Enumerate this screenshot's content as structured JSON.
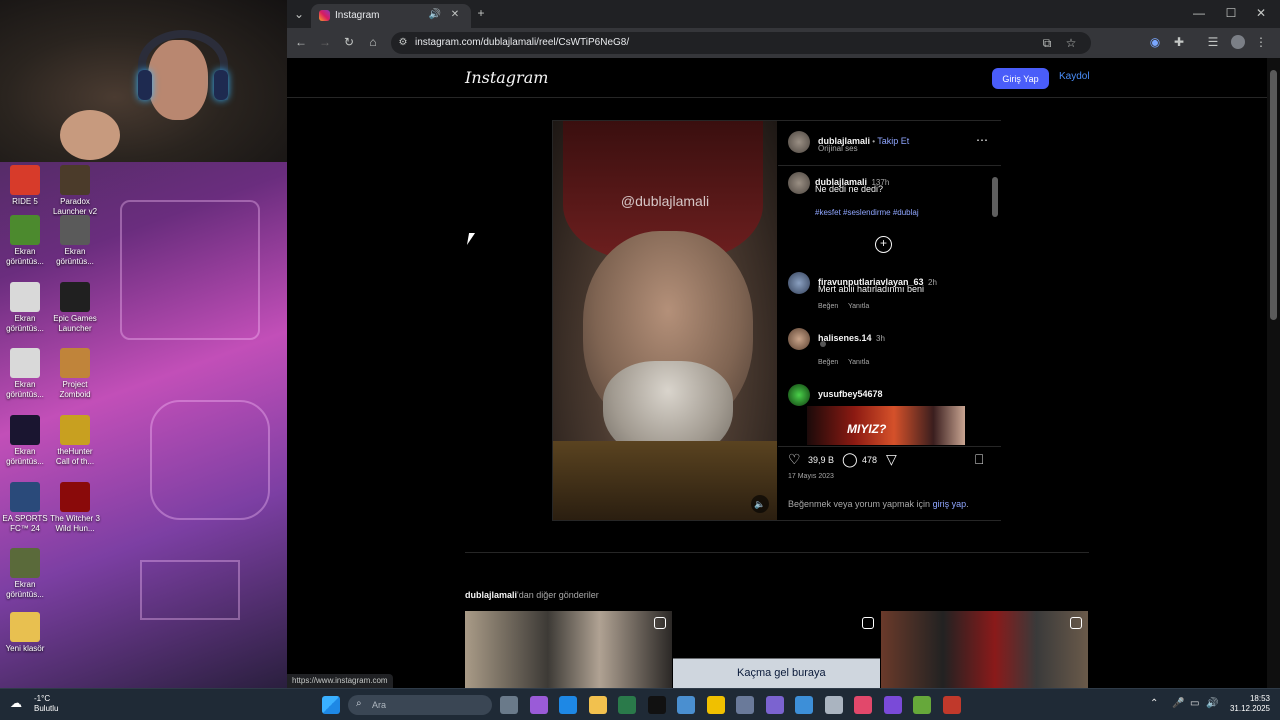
{
  "desktop": {
    "icons": [
      {
        "label": "RIDE 5",
        "color": "#d73b2a"
      },
      {
        "label": "Paradox Launcher v2",
        "color": "#4b3b2a"
      },
      {
        "label": "Ekran görüntüs...",
        "color": "#4c8a2e"
      },
      {
        "label": "Ekran görüntüs...",
        "color": "#5a5a5a"
      },
      {
        "label": "Ekran görüntüs...",
        "color": "#d9d9d9"
      },
      {
        "label": "Epic Games Launcher",
        "color": "#202020"
      },
      {
        "label": "Ekran görüntüs...",
        "color": "#d9d9d9"
      },
      {
        "label": "Project Zomboid",
        "color": "#c0843a"
      },
      {
        "label": "Ekran görüntüs...",
        "color": "#1a1530"
      },
      {
        "label": "theHunter Call of th...",
        "color": "#c8a020"
      },
      {
        "label": "EA SPORTS FC™ 24",
        "color": "#2a4a7a"
      },
      {
        "label": "The Witcher 3 Wild Hun...",
        "color": "#8a0a0a"
      },
      {
        "label": "Ekran görüntüs...",
        "color": "#5a6a3a"
      },
      {
        "label": "Yeni klasör",
        "color": "#e8c050"
      }
    ]
  },
  "browser": {
    "tab_title": "Instagram",
    "new_tab": "+",
    "url": "instagram.com/dublajlamali/reel/CsWTiP6NeG8/",
    "window_controls": {
      "minimize": "—",
      "maximize": "☐",
      "close": "✕"
    },
    "status_url": "https://www.instagram.com"
  },
  "instagram": {
    "logo": "Instagram",
    "login_label": "Giriş Yap",
    "signup_label": "Kaydol",
    "post": {
      "watermark": "@dublajlamali",
      "author": "dublajlamali",
      "follow_sep": " • ",
      "follow_label": "Takip Et",
      "audio": "Orijinal ses",
      "caption_user": "dublajlamali",
      "caption_time": "137h",
      "caption_text": "Ne dedi ne dedi?",
      "hashtags": "#kesfet #seslendirme #dublaj",
      "comments": [
        {
          "user": "firavunputlariavlayan_63",
          "time": "2h",
          "text": "Mert abiii hatırladınmı beni",
          "like": "Beğen",
          "reply": "Yanıtla"
        },
        {
          "user": "halisenes.14",
          "time": "3h",
          "text": "",
          "like": "Beğen",
          "reply": "Yanıtla"
        },
        {
          "user": "yusufbey54678",
          "time": "",
          "text": "",
          "like": "",
          "reply": ""
        }
      ],
      "comment_image_text": "MIYIZ?",
      "likes": "39,9 B",
      "comment_count": "478",
      "date": "17 Mayıs 2023",
      "login_prompt_prefix": "Beğenmek veya yorum yapmak için ",
      "login_prompt_link": "giriş yap",
      "login_prompt_suffix": "."
    },
    "more_posts_user": "dublajlamali",
    "more_posts_suffix": "'dan diğer gönderiler",
    "grid_text": "Kaçma gel buraya"
  },
  "taskbar": {
    "weather_temp": "-1°C",
    "weather_desc": "Bulutlu",
    "search_placeholder": "Ara",
    "time": "18:53",
    "date": "31.12.2025"
  }
}
